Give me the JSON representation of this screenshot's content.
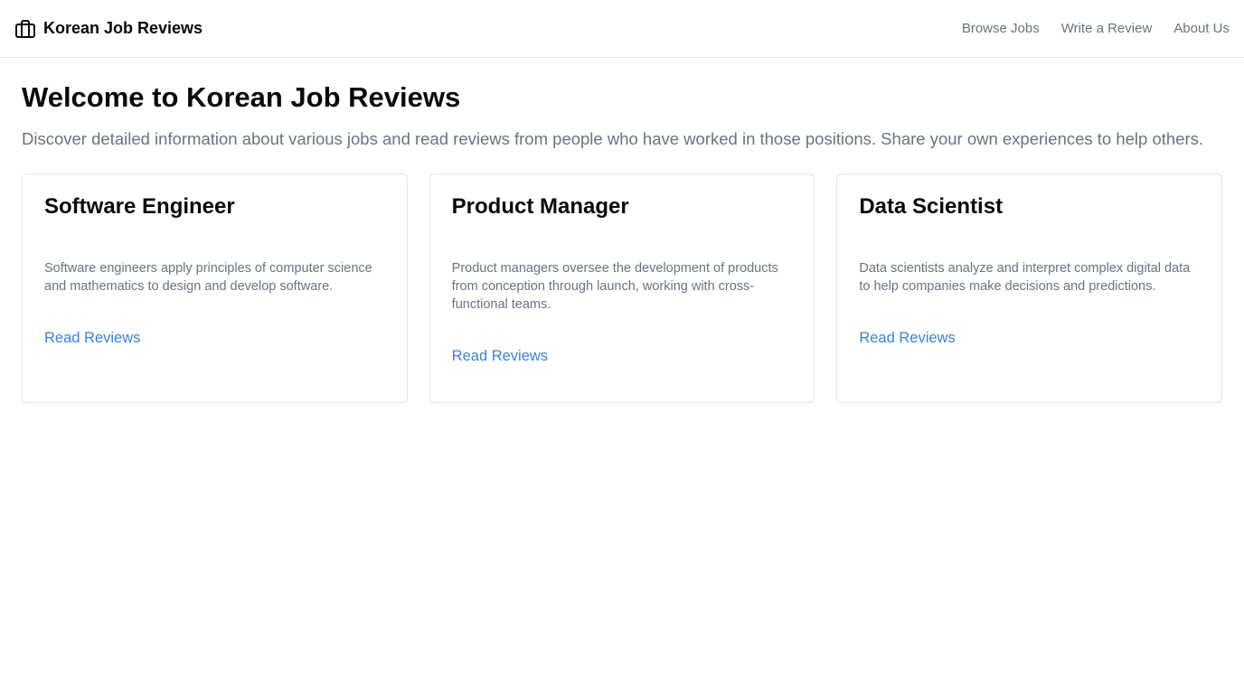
{
  "header": {
    "title": "Korean Job Reviews",
    "icon": "briefcase-icon",
    "nav": [
      {
        "label": "Browse Jobs"
      },
      {
        "label": "Write a Review"
      },
      {
        "label": "About Us"
      }
    ]
  },
  "main": {
    "title": "Welcome to Korean Job Reviews",
    "intro": "Discover detailed information about various jobs and read reviews from people who have worked in those positions. Share your own experiences to help others.",
    "cards": [
      {
        "title": "Software Engineer",
        "description": "Software engineers apply principles of computer science and mathematics to design and develop software.",
        "link": "Read Reviews"
      },
      {
        "title": "Product Manager",
        "description": "Product managers oversee the development of products from conception through launch, working with cross-functional teams.",
        "link": "Read Reviews"
      },
      {
        "title": "Data Scientist",
        "description": "Data scientists analyze and interpret complex digital data to help companies make decisions and predictions.",
        "link": "Read Reviews"
      }
    ]
  },
  "colors": {
    "text": "#0a0a0a",
    "muted": "#6b7280",
    "link": "#3b82d6",
    "border": "#e5e7eb"
  }
}
